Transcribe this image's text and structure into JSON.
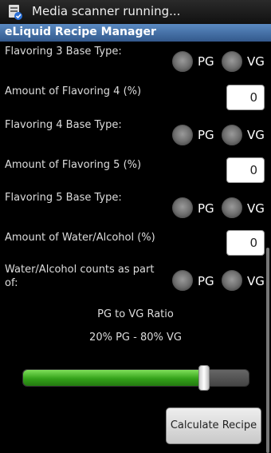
{
  "status_bar": {
    "notification": "Media scanner running..."
  },
  "app_title": "eLiquid Recipe Manager",
  "form": {
    "flavoring3_base_label": "Flavoring 3 Base Type:",
    "flavoring4_amount_label": "Amount of Flavoring 4 (%)",
    "flavoring4_amount_value": "0",
    "flavoring4_base_label": "Flavoring 4 Base Type:",
    "flavoring5_amount_label": "Amount of Flavoring 5 (%)",
    "flavoring5_amount_value": "0",
    "flavoring5_base_label": "Flavoring 5 Base Type:",
    "water_amount_label": "Amount of Water/Alcohol (%)",
    "water_amount_value": "0",
    "water_counts_label_line1": "Water/Alcohol counts as part",
    "water_counts_label_line2": "of:",
    "pg_label": "PG",
    "vg_label": "VG"
  },
  "ratio": {
    "title": "PG to VG Ratio",
    "value_text": "20% PG - 80% VG",
    "vg_percent": 80
  },
  "calculate_button": "Calculate Recipe",
  "colors": {
    "title_bar": "#4a78b0",
    "slider_fill": "#34a21a"
  }
}
